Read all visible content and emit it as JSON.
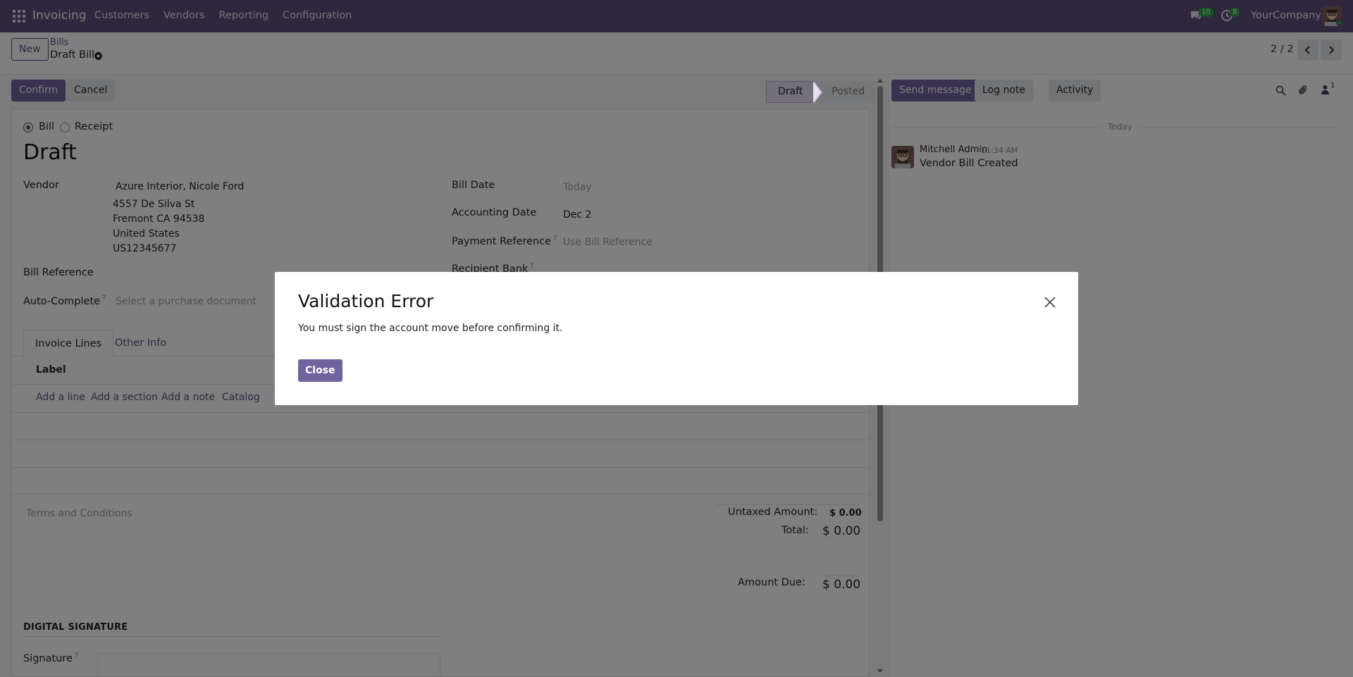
{
  "navbar": {
    "app_name": "Invoicing",
    "menu": [
      "Customers",
      "Vendors",
      "Reporting",
      "Configuration"
    ],
    "messages_count": "10",
    "activities_count": "8",
    "company": "YourCompany"
  },
  "control_panel": {
    "new_label": "New",
    "breadcrumb_parent": "Bills",
    "breadcrumb_current": "Draft Bill",
    "pager": "2 / 2"
  },
  "actions": {
    "confirm_label": "Confirm",
    "cancel_label": "Cancel",
    "status_draft": "Draft",
    "status_posted": "Posted"
  },
  "form": {
    "move_type_bill": "Bill",
    "move_type_receipt": "Receipt",
    "title": "Draft",
    "vendor_label": "Vendor",
    "vendor_name": "Azure Interior, Nicole Ford",
    "vendor_address": [
      "4557 De Silva St",
      "Fremont CA 94538",
      "United States",
      "US12345677"
    ],
    "bill_reference_label": "Bill Reference",
    "auto_complete_label": "Auto-Complete",
    "auto_complete_placeholder": "Select a purchase document",
    "help_mark": "?",
    "bill_date_label": "Bill Date",
    "bill_date_placeholder": "Today",
    "accounting_date_label": "Accounting Date",
    "accounting_date_value": "Dec 2",
    "payment_reference_label": "Payment Reference",
    "payment_reference_placeholder": "Use Bill Reference",
    "recipient_bank_label": "Recipient Bank",
    "tab_invoice_lines": "Invoice Lines",
    "tab_other_info": "Other Info",
    "column_label": "Label",
    "add_line": "Add a line",
    "add_section": "Add a section",
    "add_note": "Add a note",
    "catalog": "Catalog",
    "terms_placeholder": "Terms and Conditions",
    "untaxed_label": "Untaxed Amount:",
    "untaxed_value": "$ 0.00",
    "total_label": "Total:",
    "total_value": "$ 0.00",
    "amount_due_label": "Amount Due:",
    "amount_due_value": "$ 0.00",
    "digital_signature_title": "DIGITAL SIGNATURE",
    "signature_label": "Signature"
  },
  "chatter": {
    "send_message": "Send message",
    "log_note": "Log note",
    "activity": "Activity",
    "followers_count": "1",
    "date_separator": "Today",
    "message_author": "Mitchell Admin",
    "message_time": "11:34 AM",
    "message_body": "Vendor Bill Created"
  },
  "dialog": {
    "title": "Validation Error",
    "message": "You must sign the account move before confirming it.",
    "close_label": "Close"
  },
  "colors": {
    "navbar": "#5c4f7c",
    "primary": "#71639e",
    "link": "#5c4f7c"
  }
}
